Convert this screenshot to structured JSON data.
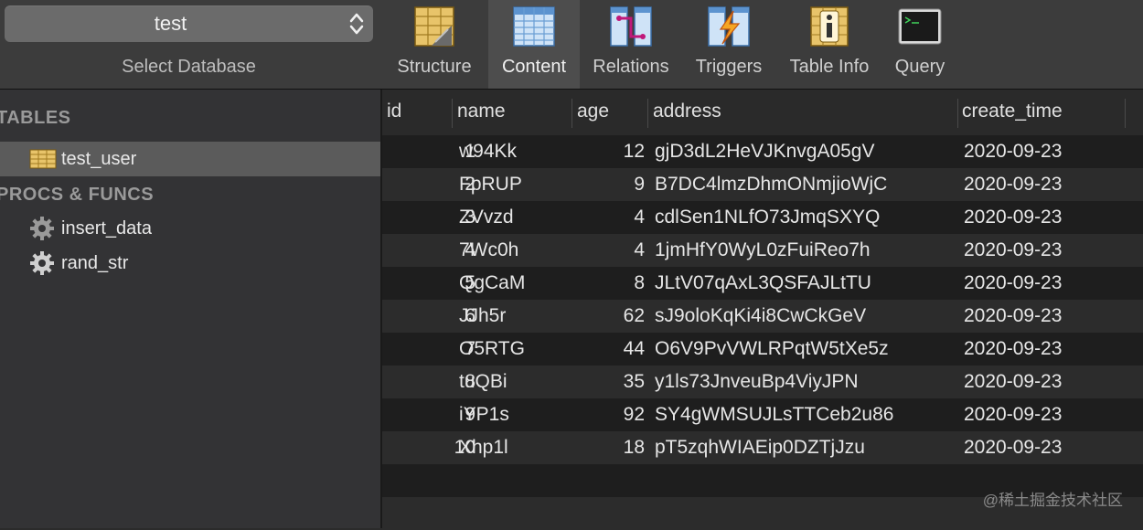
{
  "toolbar": {
    "database": {
      "selected": "test",
      "label": "Select Database"
    },
    "buttons": [
      {
        "label": "Structure",
        "icon": "structure-icon"
      },
      {
        "label": "Content",
        "icon": "content-icon"
      },
      {
        "label": "Relations",
        "icon": "relations-icon"
      },
      {
        "label": "Triggers",
        "icon": "triggers-icon"
      },
      {
        "label": "Table Info",
        "icon": "table-info-icon"
      },
      {
        "label": "Query",
        "icon": "query-icon"
      }
    ],
    "active": "Content"
  },
  "sidebar": {
    "tables_header": "TABLES",
    "tables": [
      {
        "label": "test_user",
        "icon": "table-icon"
      }
    ],
    "procs_header": "PROCS & FUNCS",
    "procs": [
      {
        "label": "insert_data",
        "icon": "gear-icon"
      },
      {
        "label": "rand_str",
        "icon": "gear-icon"
      }
    ]
  },
  "table": {
    "columns": [
      "id",
      "name",
      "age",
      "address",
      "create_time"
    ],
    "rows": [
      [
        "1",
        "w94Kk",
        "12",
        "gjD3dL2HeVJKnvgA05gV",
        "2020-09-23"
      ],
      [
        "2",
        "FpRUP",
        "9",
        "B7DC4lmzDhmONmjioWjC",
        "2020-09-23"
      ],
      [
        "3",
        "ZVvzd",
        "4",
        "cdlSen1NLfO73JmqSXYQ",
        "2020-09-23"
      ],
      [
        "4",
        "7Wc0h",
        "4",
        "1jmHfY0WyL0zFuiReo7h",
        "2020-09-23"
      ],
      [
        "5",
        "QgCaM",
        "8",
        "JLtV07qAxL3QSFAJLtTU",
        "2020-09-23"
      ],
      [
        "6",
        "JJh5r",
        "62",
        "sJ9oloKqKi4i8CwCkGeV",
        "2020-09-23"
      ],
      [
        "7",
        "O5RTG",
        "44",
        "O6V9PvVWLRPqtW5tXe5z",
        "2020-09-23"
      ],
      [
        "8",
        "tuQBi",
        "35",
        "y1ls73JnveuBp4ViyJPN",
        "2020-09-23"
      ],
      [
        "9",
        "iYP1s",
        "92",
        "SY4gWMSUJLsTTCeb2u86",
        "2020-09-23"
      ],
      [
        "10",
        "Xhp1l",
        "18",
        "pT5zqhWIAEip0DZTjJzu",
        "2020-09-23"
      ]
    ]
  },
  "watermark": "@稀土掘金技术社区"
}
